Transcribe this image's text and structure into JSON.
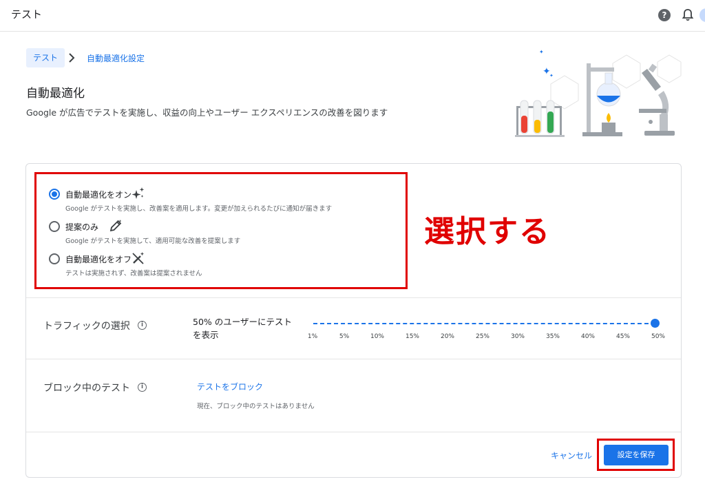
{
  "header": {
    "app_title": "テスト",
    "help_icon": "help-circle-icon",
    "bell_icon": "notifications-bell-icon"
  },
  "breadcrumb": {
    "parent": "テスト",
    "current": "自動最適化設定"
  },
  "page": {
    "title": "自動最適化",
    "description": "Google が広告でテストを実施し、収益の向上やユーザー エクスペリエンスの改善を図ります"
  },
  "options": [
    {
      "label": "自動最適化をオン",
      "description": "Google がテストを実施し、改善案を適用します。変更が加えられるたびに通知が届きます",
      "icon": "sparkle-icon",
      "selected": true
    },
    {
      "label": "提案のみ",
      "description": "Google がテストを実施して、適用可能な改善を提案します",
      "icon": "pencil-icon",
      "selected": false
    },
    {
      "label": "自動最適化をオフ",
      "description": "テストは実施されず、改善案は提案されません",
      "icon": "magic-wand-off-icon",
      "selected": false
    }
  ],
  "annotation": {
    "text": "選択する",
    "color": "#e00000"
  },
  "traffic": {
    "label": "トラフィックの選択",
    "value_text": "50% のユーザーにテストを表示",
    "value_percent": 50,
    "ticks": [
      "1%",
      "5%",
      "10%",
      "15%",
      "20%",
      "25%",
      "30%",
      "35%",
      "40%",
      "45%",
      "50%"
    ]
  },
  "blocked_tests": {
    "label": "ブロック中のテスト",
    "link": "テストをブロック",
    "note": "現在、ブロック中のテストはありません"
  },
  "footer": {
    "cancel": "キャンセル",
    "save": "設定を保存"
  },
  "colors": {
    "accent": "#1a73e8",
    "highlight": "#e00000"
  }
}
